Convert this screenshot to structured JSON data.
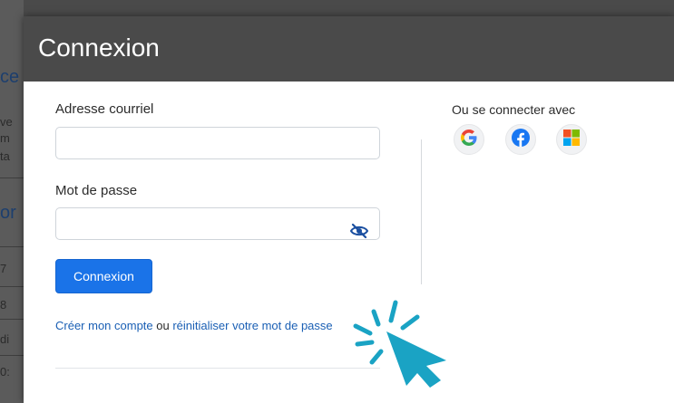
{
  "modal": {
    "title": "Connexion"
  },
  "form": {
    "email_label": "Adresse courriel",
    "email_value": "",
    "email_placeholder": "",
    "password_label": "Mot de passe",
    "password_value": "",
    "password_placeholder": "",
    "submit_label": "Connexion",
    "create_account_label": "Créer mon compte",
    "or_text": " ou ",
    "reset_password_label": "réinitialiser votre mot de passe"
  },
  "social": {
    "label": "Ou se connecter avec",
    "providers": [
      {
        "name": "google-icon"
      },
      {
        "name": "facebook-icon"
      },
      {
        "name": "microsoft-icon"
      }
    ]
  },
  "background": {
    "fragments": [
      "ce",
      "ve",
      "m",
      "ta",
      "or",
      "7",
      "8",
      "di",
      "0:"
    ]
  },
  "colors": {
    "header": "#4a4a4a",
    "primary": "#1a73e8",
    "link": "#1a5fb4",
    "cursor": "#1aa3c4"
  }
}
